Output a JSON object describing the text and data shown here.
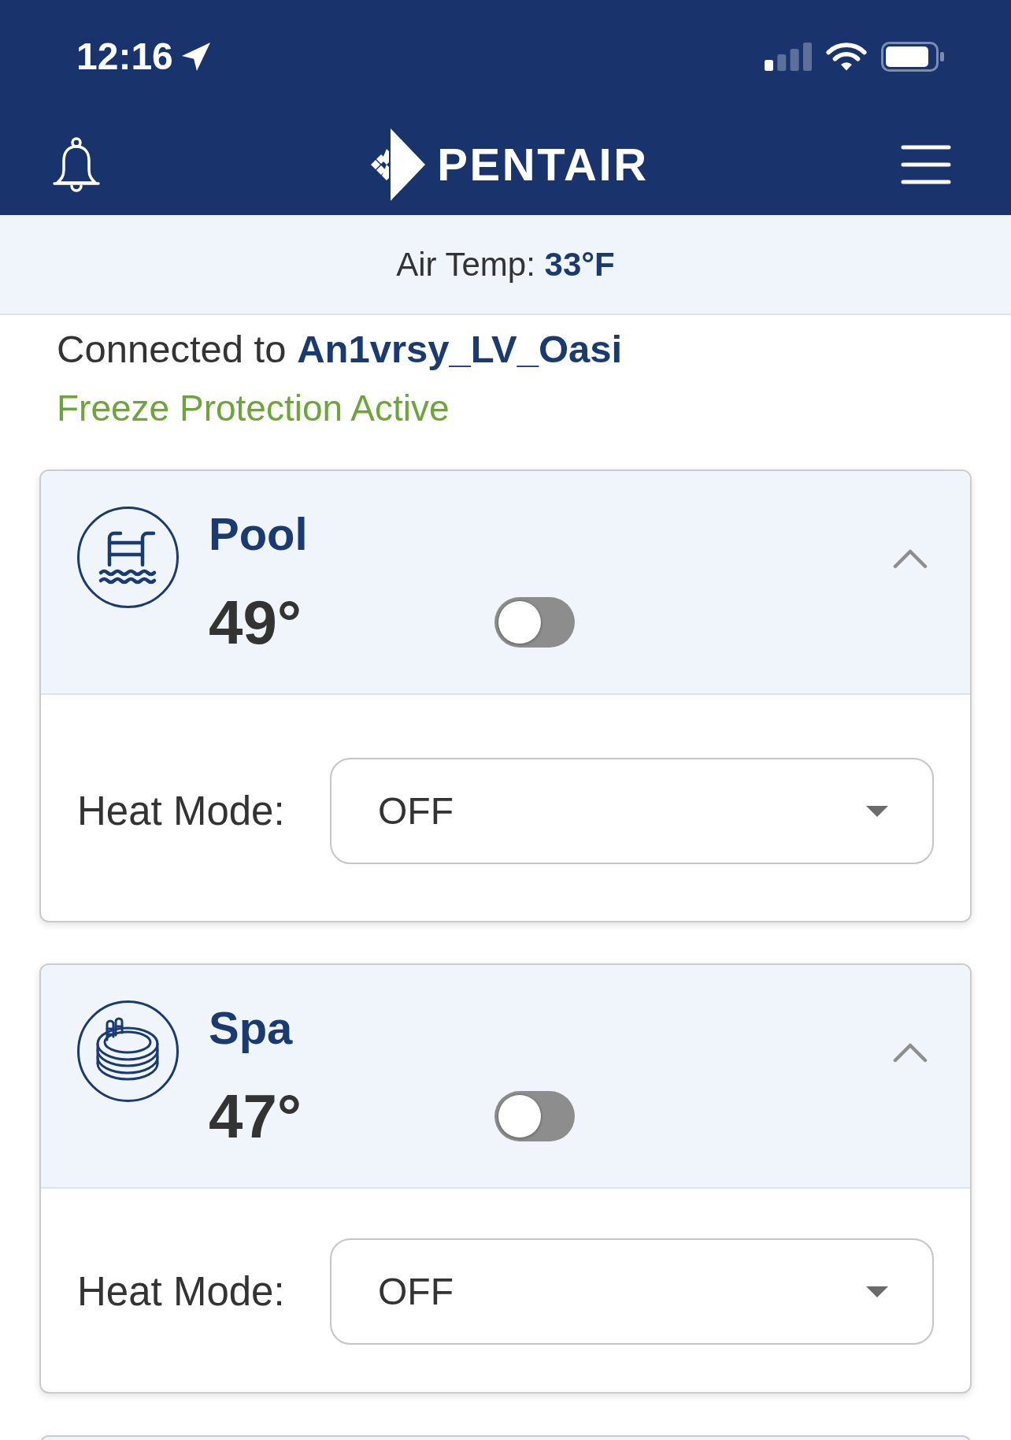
{
  "status_bar": {
    "time": "12:16"
  },
  "header": {
    "logo": "PENTAIR"
  },
  "air_temp": {
    "label": "Air Temp:",
    "value": "33°F"
  },
  "connection": {
    "label": "Connected to",
    "name": "An1vrsy_LV_Oasi",
    "status": "Freeze Protection Active"
  },
  "bodies": [
    {
      "kind": "pool",
      "name": "Pool",
      "temperature": "49°",
      "on": false,
      "expanded": true,
      "heat_mode": {
        "label": "Heat Mode:",
        "value": "OFF"
      }
    },
    {
      "kind": "spa",
      "name": "Spa",
      "temperature": "47°",
      "on": false,
      "expanded": true,
      "heat_mode": {
        "label": "Heat Mode:",
        "value": "OFF"
      }
    }
  ]
}
